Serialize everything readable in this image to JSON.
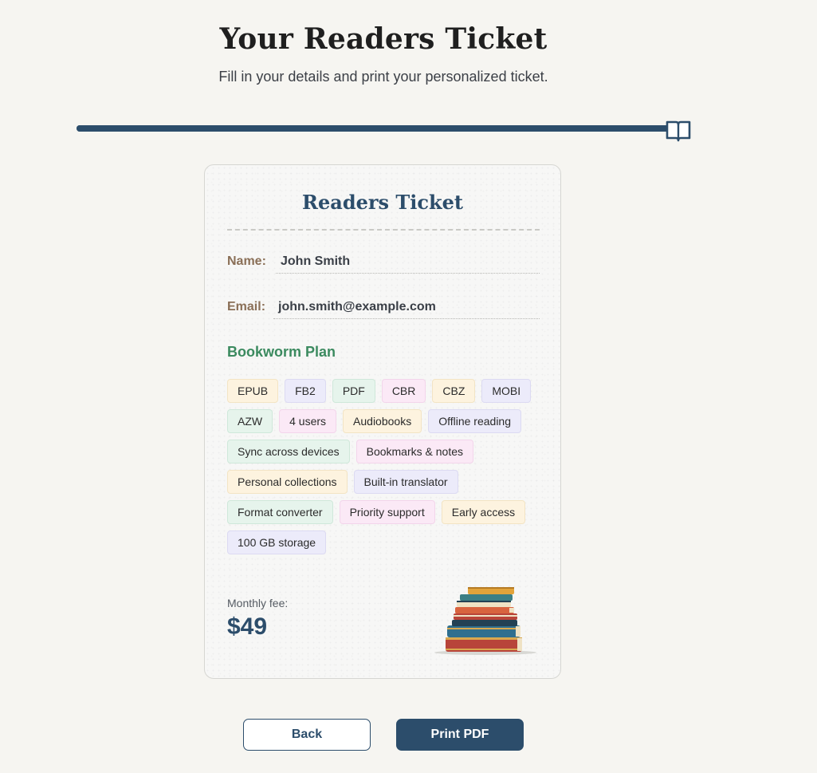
{
  "header": {
    "title": "Your Readers Ticket",
    "subtitle": "Fill in your details and print your personalized ticket."
  },
  "progress": {
    "value": 1.0,
    "marker_icon": "open-book-icon"
  },
  "ticket": {
    "title": "Readers Ticket",
    "name_label": "Name:",
    "name_value": "John Smith",
    "email_label": "Email:",
    "email_value": "john.smith@example.com",
    "plan_name": "Bookworm Plan",
    "features": [
      "EPUB",
      "FB2",
      "PDF",
      "CBR",
      "CBZ",
      "MOBI",
      "AZW",
      "4 users",
      "Audiobooks",
      "Offline reading",
      "Sync across devices",
      "Bookmarks & notes",
      "Personal collections",
      "Built-in translator",
      "Format converter",
      "Priority support",
      "Early access",
      "100 GB storage"
    ],
    "fee_label": "Monthly fee:",
    "fee_value": "$49",
    "illustration": "book-stack-icon"
  },
  "actions": {
    "back_label": "Back",
    "print_label": "Print PDF"
  },
  "colors": {
    "accent": "#2c4d6b",
    "plan": "#3b8a5f",
    "label": "#8a6f57",
    "background": "#f6f5f1"
  }
}
